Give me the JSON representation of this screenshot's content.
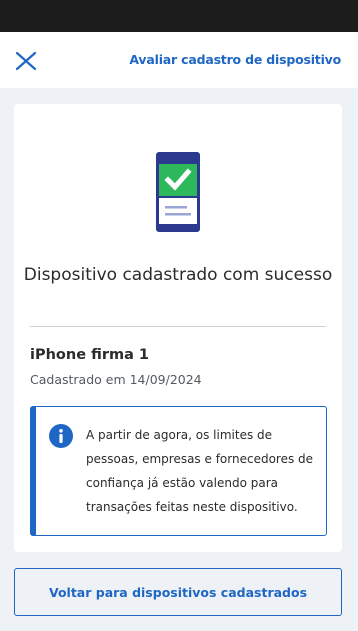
{
  "header": {
    "link_label": "Avaliar cadastro de dispositivo",
    "close_icon": "close-icon"
  },
  "card": {
    "illustration_icon": "phone-check-icon",
    "title": "Dispositivo cadastrado com sucesso",
    "device_name": "iPhone firma 1",
    "device_registered": "Cadastrado em 14/09/2024",
    "info": {
      "icon": "info-icon",
      "text": "A partir de agora, os limites de pessoas, empresas e fornecedores de confiança já estão valendo para transações feitas neste dispositivo."
    }
  },
  "footer": {
    "back_button_label": "Voltar para dispositivos cadastrados"
  },
  "colors": {
    "accent": "#1f67c4",
    "success": "#2eb85c",
    "phone": "#2b3a8f",
    "background": "#eef1f5",
    "status_bar": "#1c1c1c"
  }
}
